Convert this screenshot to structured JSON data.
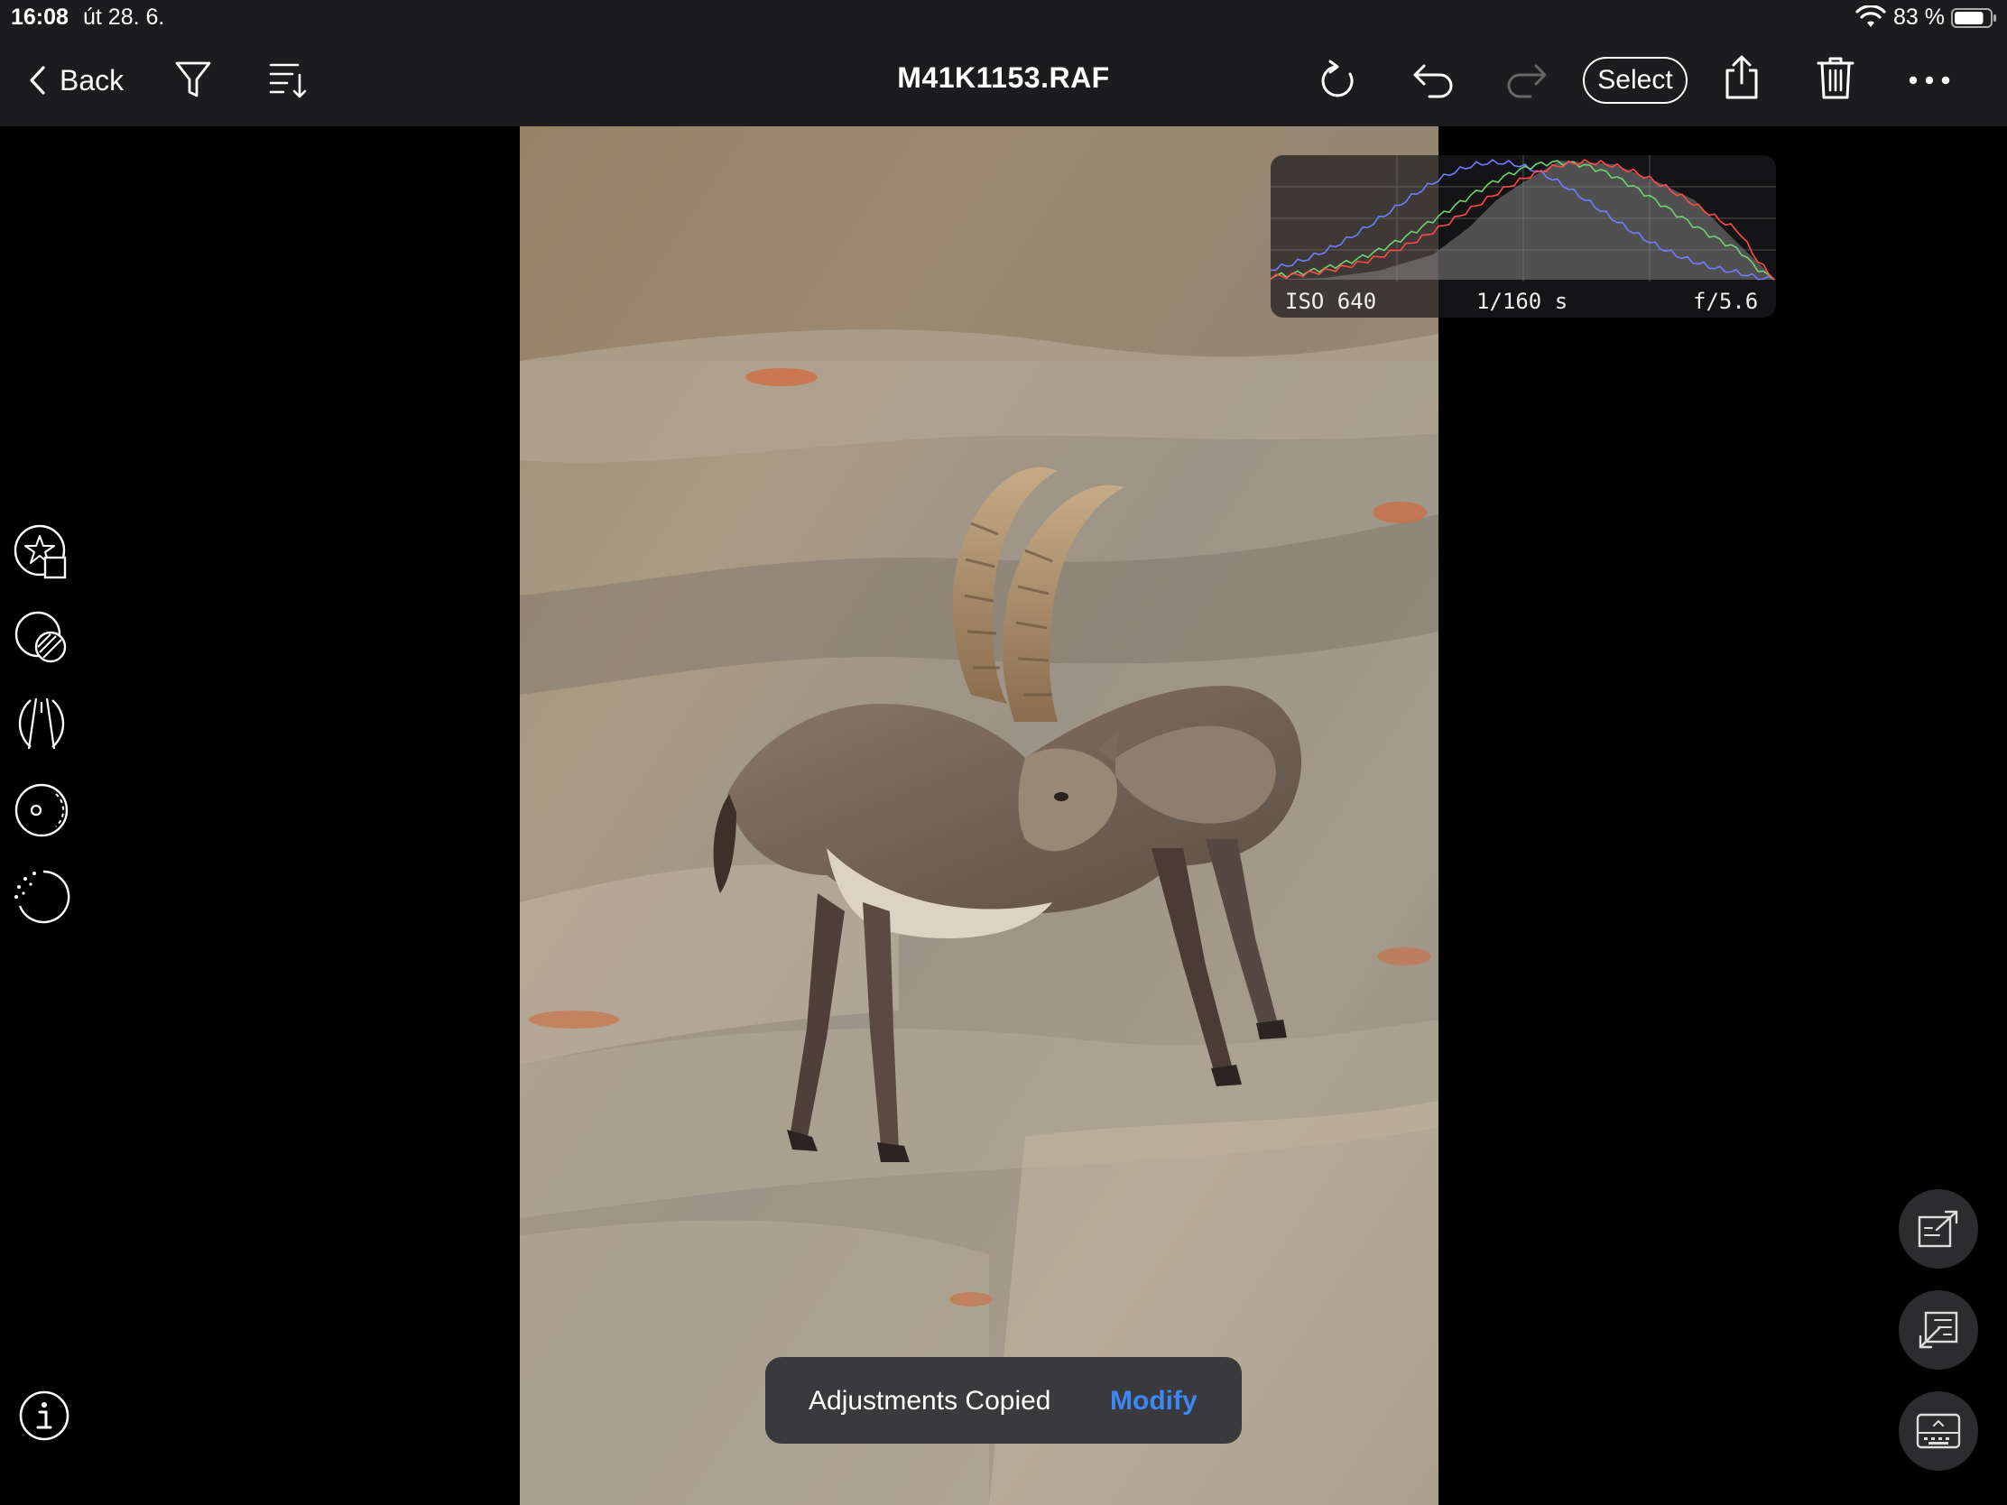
{
  "status_bar": {
    "time": "16:08",
    "date": "út 28. 6.",
    "battery_percent": "83 %",
    "battery_level": 0.83
  },
  "toolbar": {
    "back_label": "Back",
    "file_name": "M41K1153.RAF",
    "select_label": "Select",
    "icons": [
      "filter-icon",
      "sort-icon",
      "rotate-icon",
      "undo-icon",
      "redo-icon",
      "share-icon",
      "trash-icon",
      "more-icon"
    ]
  },
  "histogram": {
    "iso": "ISO 640",
    "shutter": "1/160 s",
    "aperture": "f/5.6",
    "colors": {
      "red": "#ff4a4a",
      "green": "#6fd36f",
      "blue": "#6f7dff",
      "luma": "#ffffff"
    }
  },
  "left_tools": [
    "star-rating-icon",
    "mask-icon",
    "lens-correction-icon",
    "vignette-icon",
    "radial-dots-icon"
  ],
  "right_tools": [
    "export-icon",
    "import-icon",
    "keyboard-panel-icon"
  ],
  "toast": {
    "message": "Adjustments Copied",
    "action": "Modify",
    "action_color": "#3d86f5"
  }
}
